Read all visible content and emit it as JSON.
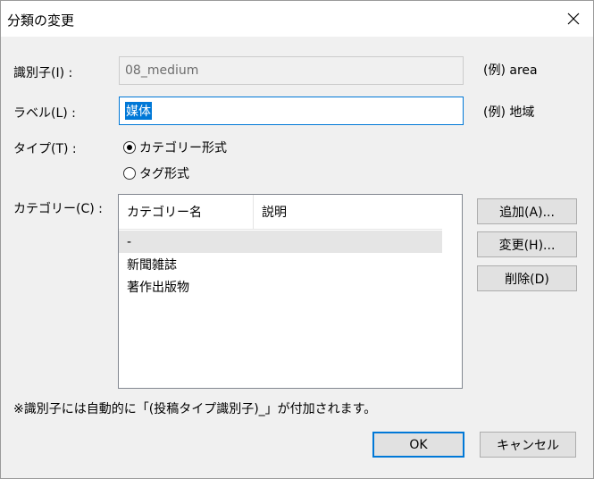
{
  "window": {
    "title": "分類の変更",
    "close_glyph": "✕"
  },
  "form": {
    "identifier": {
      "label": "識別子(I) :",
      "value": "08_medium",
      "example": "(例) area"
    },
    "label_field": {
      "label": "ラベル(L) :",
      "value": "媒体",
      "example": "(例) 地域"
    },
    "type": {
      "label": "タイプ(T) :",
      "options": [
        {
          "label": "カテゴリー形式",
          "selected": true
        },
        {
          "label": "タグ形式",
          "selected": false
        }
      ]
    },
    "category": {
      "label": "カテゴリー(C) :",
      "columns": [
        "カテゴリー名",
        "説明"
      ],
      "rows": [
        {
          "name": "-",
          "description": "",
          "selected": true
        },
        {
          "name": "新聞雑誌",
          "description": "",
          "selected": false
        },
        {
          "name": "著作出版物",
          "description": "",
          "selected": false
        }
      ]
    }
  },
  "buttons": {
    "add": "追加(A)...",
    "edit": "変更(H)...",
    "delete": "削除(D)",
    "ok": "OK",
    "cancel": "キャンセル"
  },
  "note": "※識別子には自動的に「(投稿タイプ識別子)_」が付加されます。"
}
